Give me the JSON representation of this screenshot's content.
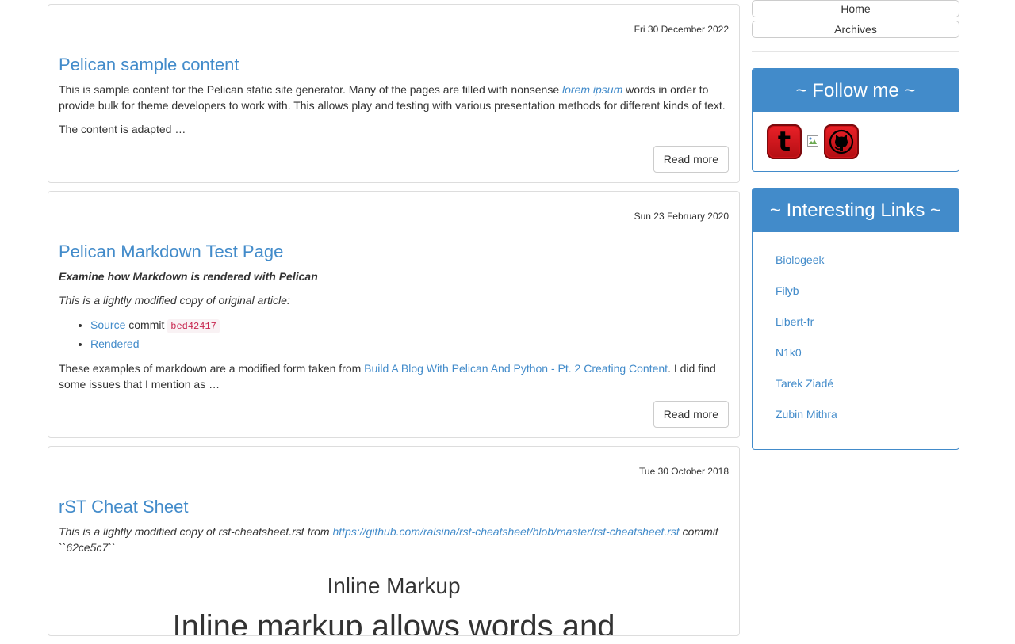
{
  "posts": [
    {
      "date": "Fri 30 December 2022",
      "title": "Pelican sample content",
      "p1_before": "This is sample content for the Pelican static site generator. Many of the pages are filled with nonsense ",
      "p1_link": "lorem ipsum",
      "p1_after": " words in order to provide bulk for theme developers to work with. This allows play and testing with various presentation methods for different kinds of text.",
      "p2": "The content is adapted …",
      "read_more": "Read more"
    },
    {
      "date": "Sun 23 February 2020",
      "title": "Pelican Markdown Test Page",
      "subtitle": "Examine how Markdown is rendered with Pelican",
      "intro": "This is a lightly modified copy of original article:",
      "list": {
        "source_link": "Source",
        "commit_text": " commit ",
        "commit_code": "bed42417",
        "rendered_link": "Rendered"
      },
      "p_before": "These examples of markdown are a modified form taken from ",
      "p_link": "Build A Blog With Pelican And Python - Pt. 2 Creating Content",
      "p_after": ". I did find some issues that I mention as …",
      "read_more": "Read more"
    },
    {
      "date": "Tue 30 October 2018",
      "title": "rST Cheat Sheet",
      "p_before": "This is a lightly modified copy of rst-cheatsheet.rst from ",
      "p_link": "https://github.com/ralsina/rst-cheatsheet/blob/master/rst-cheatsheet.rst",
      "p_after": " commit ``62ce5c7``",
      "heading": "Inline Markup",
      "big_text": "Inline markup allows words and"
    }
  ],
  "sidebar": {
    "nav": [
      "Home",
      "Archives"
    ],
    "follow_title": "~ Follow me ~",
    "social": {
      "twitter_glyph": "t"
    },
    "links_title": "~ Interesting Links ~",
    "links": [
      "Biologeek",
      "Filyb",
      "Libert-fr",
      "N1k0",
      "Tarek Ziadé",
      "Zubin Mithra"
    ]
  }
}
